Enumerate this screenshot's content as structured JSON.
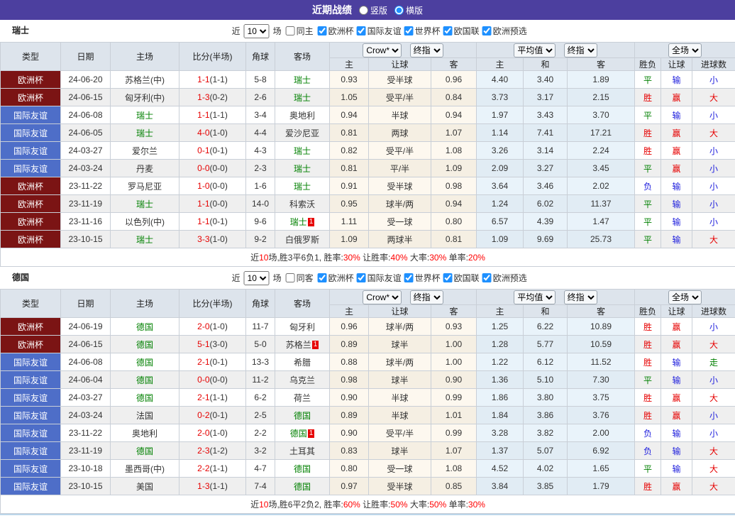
{
  "header": {
    "title": "近期战绩",
    "radio_vertical": "竖版",
    "radio_horizontal": "横版"
  },
  "colors": {
    "titlebar_bg": "#4c3f9f",
    "euro_cup_bg": "#7b1414",
    "friendly_bg": "#4e6ec8",
    "win_red": "#e60000",
    "draw_green": "#008000",
    "lose_blue": "#2020dd"
  },
  "filter": {
    "near": "近",
    "games": "场",
    "leagues": [
      "欧洲杯",
      "国际友谊",
      "世界杯",
      "欧国联",
      "欧洲预选"
    ]
  },
  "dropdowns": {
    "count": "10",
    "bookmaker": "Crow*",
    "final1": "终指",
    "average": "平均值",
    "final2": "终指",
    "full_match": "全场"
  },
  "columns": {
    "left": [
      "类型",
      "日期",
      "主场",
      "比分(半场)",
      "角球",
      "客场"
    ],
    "odds": [
      "主",
      "让球",
      "客",
      "主",
      "和",
      "客",
      "胜负",
      "让球",
      "进球数"
    ]
  },
  "sections": [
    {
      "team": "瑞士",
      "same_label": "同主",
      "rows": [
        {
          "type": "欧洲杯",
          "type_class": "euro",
          "date": "24-06-20",
          "home": "苏格兰(中)",
          "home_green": false,
          "home_card": null,
          "score_ft": "1-1",
          "score_ht": "(1-1)",
          "corner": "5-8",
          "away": "瑞士",
          "away_green": true,
          "away_card": null,
          "o1": "0.93",
          "handicap": "受半球",
          "o2": "0.96",
          "avg1": "4.40",
          "avg2": "3.40",
          "avg3": "1.89",
          "res_wdl": "平",
          "res_wdl_c": "green",
          "res_hcp": "输",
          "res_hcp_c": "blue",
          "res_goal": "小",
          "res_goal_c": "blue"
        },
        {
          "type": "欧洲杯",
          "type_class": "euro",
          "date": "24-06-15",
          "home": "匈牙利(中)",
          "home_green": false,
          "home_card": null,
          "score_ft": "1-3",
          "score_ht": "(0-2)",
          "corner": "2-6",
          "away": "瑞士",
          "away_green": true,
          "away_card": null,
          "o1": "1.05",
          "handicap": "受平/半",
          "o2": "0.84",
          "avg1": "3.73",
          "avg2": "3.17",
          "avg3": "2.15",
          "res_wdl": "胜",
          "res_wdl_c": "red",
          "res_hcp": "赢",
          "res_hcp_c": "red",
          "res_goal": "大",
          "res_goal_c": "red"
        },
        {
          "type": "国际友谊",
          "type_class": "friendly",
          "date": "24-06-08",
          "home": "瑞士",
          "home_green": true,
          "home_card": null,
          "score_ft": "1-1",
          "score_ht": "(1-1)",
          "corner": "3-4",
          "away": "奥地利",
          "away_green": false,
          "away_card": null,
          "o1": "0.94",
          "handicap": "半球",
          "o2": "0.94",
          "avg1": "1.97",
          "avg2": "3.43",
          "avg3": "3.70",
          "res_wdl": "平",
          "res_wdl_c": "green",
          "res_hcp": "输",
          "res_hcp_c": "blue",
          "res_goal": "小",
          "res_goal_c": "blue"
        },
        {
          "type": "国际友谊",
          "type_class": "friendly",
          "date": "24-06-05",
          "home": "瑞士",
          "home_green": true,
          "home_card": null,
          "score_ft": "4-0",
          "score_ht": "(1-0)",
          "corner": "4-4",
          "away": "爱沙尼亚",
          "away_green": false,
          "away_card": null,
          "o1": "0.81",
          "handicap": "两球",
          "o2": "1.07",
          "avg1": "1.14",
          "avg2": "7.41",
          "avg3": "17.21",
          "res_wdl": "胜",
          "res_wdl_c": "red",
          "res_hcp": "赢",
          "res_hcp_c": "red",
          "res_goal": "大",
          "res_goal_c": "red"
        },
        {
          "type": "国际友谊",
          "type_class": "friendly",
          "date": "24-03-27",
          "home": "爱尔兰",
          "home_green": false,
          "home_card": null,
          "score_ft": "0-1",
          "score_ht": "(0-1)",
          "corner": "4-3",
          "away": "瑞士",
          "away_green": true,
          "away_card": null,
          "o1": "0.82",
          "handicap": "受平/半",
          "o2": "1.08",
          "avg1": "3.26",
          "avg2": "3.14",
          "avg3": "2.24",
          "res_wdl": "胜",
          "res_wdl_c": "red",
          "res_hcp": "赢",
          "res_hcp_c": "red",
          "res_goal": "小",
          "res_goal_c": "blue"
        },
        {
          "type": "国际友谊",
          "type_class": "friendly",
          "date": "24-03-24",
          "home": "丹麦",
          "home_green": false,
          "home_card": null,
          "score_ft": "0-0",
          "score_ht": "(0-0)",
          "corner": "2-3",
          "away": "瑞士",
          "away_green": true,
          "away_card": null,
          "o1": "0.81",
          "handicap": "平/半",
          "o2": "1.09",
          "avg1": "2.09",
          "avg2": "3.27",
          "avg3": "3.45",
          "res_wdl": "平",
          "res_wdl_c": "green",
          "res_hcp": "赢",
          "res_hcp_c": "red",
          "res_goal": "小",
          "res_goal_c": "blue"
        },
        {
          "type": "欧洲杯",
          "type_class": "euro",
          "date": "23-11-22",
          "home": "罗马尼亚",
          "home_green": false,
          "home_card": null,
          "score_ft": "1-0",
          "score_ht": "(0-0)",
          "corner": "1-6",
          "away": "瑞士",
          "away_green": true,
          "away_card": null,
          "o1": "0.91",
          "handicap": "受半球",
          "o2": "0.98",
          "avg1": "3.64",
          "avg2": "3.46",
          "avg3": "2.02",
          "res_wdl": "负",
          "res_wdl_c": "blue",
          "res_hcp": "输",
          "res_hcp_c": "blue",
          "res_goal": "小",
          "res_goal_c": "blue"
        },
        {
          "type": "欧洲杯",
          "type_class": "euro",
          "date": "23-11-19",
          "home": "瑞士",
          "home_green": true,
          "home_card": null,
          "score_ft": "1-1",
          "score_ht": "(0-0)",
          "corner": "14-0",
          "away": "科索沃",
          "away_green": false,
          "away_card": null,
          "o1": "0.95",
          "handicap": "球半/两",
          "o2": "0.94",
          "avg1": "1.24",
          "avg2": "6.02",
          "avg3": "11.37",
          "res_wdl": "平",
          "res_wdl_c": "green",
          "res_hcp": "输",
          "res_hcp_c": "blue",
          "res_goal": "小",
          "res_goal_c": "blue"
        },
        {
          "type": "欧洲杯",
          "type_class": "euro",
          "date": "23-11-16",
          "home": "以色列(中)",
          "home_green": false,
          "home_card": null,
          "score_ft": "1-1",
          "score_ht": "(0-1)",
          "corner": "9-6",
          "away": "瑞士",
          "away_green": true,
          "away_card": "1",
          "o1": "1.11",
          "handicap": "受一球",
          "o2": "0.80",
          "avg1": "6.57",
          "avg2": "4.39",
          "avg3": "1.47",
          "res_wdl": "平",
          "res_wdl_c": "green",
          "res_hcp": "输",
          "res_hcp_c": "blue",
          "res_goal": "小",
          "res_goal_c": "blue"
        },
        {
          "type": "欧洲杯",
          "type_class": "euro",
          "date": "23-10-15",
          "home": "瑞士",
          "home_green": true,
          "home_card": null,
          "score_ft": "3-3",
          "score_ht": "(1-0)",
          "corner": "9-2",
          "away": "白俄罗斯",
          "away_green": false,
          "away_card": null,
          "o1": "1.09",
          "handicap": "两球半",
          "o2": "0.81",
          "avg1": "1.09",
          "avg2": "9.69",
          "avg3": "25.73",
          "res_wdl": "平",
          "res_wdl_c": "green",
          "res_hcp": "输",
          "res_hcp_c": "blue",
          "res_goal": "大",
          "res_goal_c": "red"
        }
      ],
      "summary": [
        {
          "t": "近"
        },
        {
          "t": "10",
          "red": true
        },
        {
          "t": "场,胜3平6负1, 胜率:"
        },
        {
          "t": "30%",
          "red": true
        },
        {
          "t": " 让胜率:"
        },
        {
          "t": "40%",
          "red": true
        },
        {
          "t": " 大率:"
        },
        {
          "t": "30%",
          "red": true
        },
        {
          "t": " 单率:"
        },
        {
          "t": "20%",
          "red": true
        }
      ]
    },
    {
      "team": "德国",
      "same_label": "同客",
      "rows": [
        {
          "type": "欧洲杯",
          "type_class": "euro",
          "date": "24-06-19",
          "home": "德国",
          "home_green": true,
          "home_card": null,
          "score_ft": "2-0",
          "score_ht": "(1-0)",
          "corner": "11-7",
          "away": "匈牙利",
          "away_green": false,
          "away_card": null,
          "o1": "0.96",
          "handicap": "球半/两",
          "o2": "0.93",
          "avg1": "1.25",
          "avg2": "6.22",
          "avg3": "10.89",
          "res_wdl": "胜",
          "res_wdl_c": "red",
          "res_hcp": "赢",
          "res_hcp_c": "red",
          "res_goal": "小",
          "res_goal_c": "blue"
        },
        {
          "type": "欧洲杯",
          "type_class": "euro",
          "date": "24-06-15",
          "home": "德国",
          "home_green": true,
          "home_card": null,
          "score_ft": "5-1",
          "score_ht": "(3-0)",
          "corner": "5-0",
          "away": "苏格兰",
          "away_green": false,
          "away_card": "1",
          "o1": "0.89",
          "handicap": "球半",
          "o2": "1.00",
          "avg1": "1.28",
          "avg2": "5.77",
          "avg3": "10.59",
          "res_wdl": "胜",
          "res_wdl_c": "red",
          "res_hcp": "赢",
          "res_hcp_c": "red",
          "res_goal": "大",
          "res_goal_c": "red"
        },
        {
          "type": "国际友谊",
          "type_class": "friendly",
          "date": "24-06-08",
          "home": "德国",
          "home_green": true,
          "home_card": null,
          "score_ft": "2-1",
          "score_ht": "(0-1)",
          "corner": "13-3",
          "away": "希腊",
          "away_green": false,
          "away_card": null,
          "o1": "0.88",
          "handicap": "球半/两",
          "o2": "1.00",
          "avg1": "1.22",
          "avg2": "6.12",
          "avg3": "11.52",
          "res_wdl": "胜",
          "res_wdl_c": "red",
          "res_hcp": "输",
          "res_hcp_c": "blue",
          "res_goal": "走",
          "res_goal_c": "green"
        },
        {
          "type": "国际友谊",
          "type_class": "friendly",
          "date": "24-06-04",
          "home": "德国",
          "home_green": true,
          "home_card": null,
          "score_ft": "0-0",
          "score_ht": "(0-0)",
          "corner": "11-2",
          "away": "乌克兰",
          "away_green": false,
          "away_card": null,
          "o1": "0.98",
          "handicap": "球半",
          "o2": "0.90",
          "avg1": "1.36",
          "avg2": "5.10",
          "avg3": "7.30",
          "res_wdl": "平",
          "res_wdl_c": "green",
          "res_hcp": "输",
          "res_hcp_c": "blue",
          "res_goal": "小",
          "res_goal_c": "blue"
        },
        {
          "type": "国际友谊",
          "type_class": "friendly",
          "date": "24-03-27",
          "home": "德国",
          "home_green": true,
          "home_card": null,
          "score_ft": "2-1",
          "score_ht": "(1-1)",
          "corner": "6-2",
          "away": "荷兰",
          "away_green": false,
          "away_card": null,
          "o1": "0.90",
          "handicap": "半球",
          "o2": "0.99",
          "avg1": "1.86",
          "avg2": "3.80",
          "avg3": "3.75",
          "res_wdl": "胜",
          "res_wdl_c": "red",
          "res_hcp": "赢",
          "res_hcp_c": "red",
          "res_goal": "大",
          "res_goal_c": "red"
        },
        {
          "type": "国际友谊",
          "type_class": "friendly",
          "date": "24-03-24",
          "home": "法国",
          "home_green": false,
          "home_card": null,
          "score_ft": "0-2",
          "score_ht": "(0-1)",
          "corner": "2-5",
          "away": "德国",
          "away_green": true,
          "away_card": null,
          "o1": "0.89",
          "handicap": "半球",
          "o2": "1.01",
          "avg1": "1.84",
          "avg2": "3.86",
          "avg3": "3.76",
          "res_wdl": "胜",
          "res_wdl_c": "red",
          "res_hcp": "赢",
          "res_hcp_c": "red",
          "res_goal": "小",
          "res_goal_c": "blue"
        },
        {
          "type": "国际友谊",
          "type_class": "friendly",
          "date": "23-11-22",
          "home": "奥地利",
          "home_green": false,
          "home_card": null,
          "score_ft": "2-0",
          "score_ht": "(1-0)",
          "corner": "2-2",
          "away": "德国",
          "away_green": true,
          "away_card": "1",
          "o1": "0.90",
          "handicap": "受平/半",
          "o2": "0.99",
          "avg1": "3.28",
          "avg2": "3.82",
          "avg3": "2.00",
          "res_wdl": "负",
          "res_wdl_c": "blue",
          "res_hcp": "输",
          "res_hcp_c": "blue",
          "res_goal": "小",
          "res_goal_c": "blue"
        },
        {
          "type": "国际友谊",
          "type_class": "friendly",
          "date": "23-11-19",
          "home": "德国",
          "home_green": true,
          "home_card": null,
          "score_ft": "2-3",
          "score_ht": "(1-2)",
          "corner": "3-2",
          "away": "土耳其",
          "away_green": false,
          "away_card": null,
          "o1": "0.83",
          "handicap": "球半",
          "o2": "1.07",
          "avg1": "1.37",
          "avg2": "5.07",
          "avg3": "6.92",
          "res_wdl": "负",
          "res_wdl_c": "blue",
          "res_hcp": "输",
          "res_hcp_c": "blue",
          "res_goal": "大",
          "res_goal_c": "red"
        },
        {
          "type": "国际友谊",
          "type_class": "friendly",
          "date": "23-10-18",
          "home": "墨西哥(中)",
          "home_green": false,
          "home_card": null,
          "score_ft": "2-2",
          "score_ht": "(1-1)",
          "corner": "4-7",
          "away": "德国",
          "away_green": true,
          "away_card": null,
          "o1": "0.80",
          "handicap": "受一球",
          "o2": "1.08",
          "avg1": "4.52",
          "avg2": "4.02",
          "avg3": "1.65",
          "res_wdl": "平",
          "res_wdl_c": "green",
          "res_hcp": "输",
          "res_hcp_c": "blue",
          "res_goal": "大",
          "res_goal_c": "red"
        },
        {
          "type": "国际友谊",
          "type_class": "friendly",
          "date": "23-10-15",
          "home": "美国",
          "home_green": false,
          "home_card": null,
          "score_ft": "1-3",
          "score_ht": "(1-1)",
          "corner": "7-4",
          "away": "德国",
          "away_green": true,
          "away_card": null,
          "o1": "0.97",
          "handicap": "受半球",
          "o2": "0.85",
          "avg1": "3.84",
          "avg2": "3.85",
          "avg3": "1.79",
          "res_wdl": "胜",
          "res_wdl_c": "red",
          "res_hcp": "赢",
          "res_hcp_c": "red",
          "res_goal": "大",
          "res_goal_c": "red"
        }
      ],
      "summary": [
        {
          "t": "近"
        },
        {
          "t": "10",
          "red": true
        },
        {
          "t": "场,胜6平2负2, 胜率:"
        },
        {
          "t": "60%",
          "red": true
        },
        {
          "t": " 让胜率:"
        },
        {
          "t": "50%",
          "red": true
        },
        {
          "t": " 大率:"
        },
        {
          "t": "50%",
          "red": true
        },
        {
          "t": " 单率:"
        },
        {
          "t": "30%",
          "red": true
        }
      ]
    }
  ]
}
